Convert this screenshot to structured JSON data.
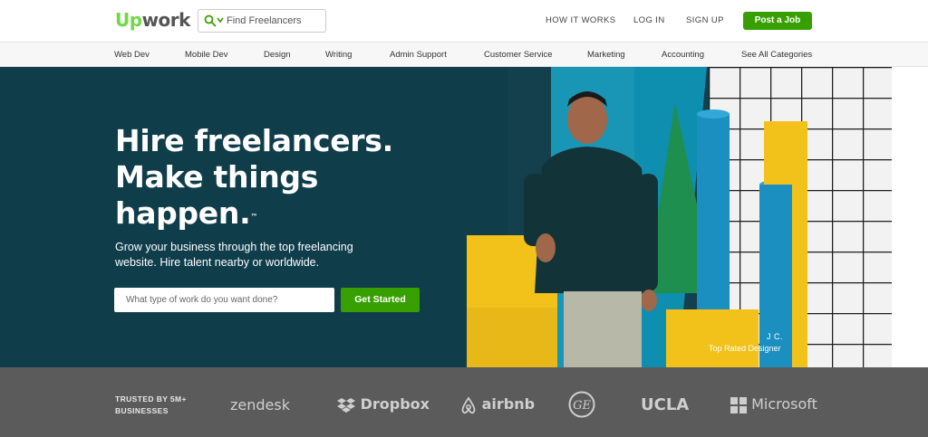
{
  "header": {
    "logo_up": "Up",
    "logo_work": "work",
    "search_placeholder": "Find Freelancers",
    "how_it_works": "HOW IT WORKS",
    "login": "LOG IN",
    "signup": "SIGN UP",
    "post_job": "Post a Job"
  },
  "categories": [
    "Web Dev",
    "Mobile Dev",
    "Design",
    "Writing",
    "Admin Support",
    "Customer Service",
    "Marketing",
    "Accounting",
    "See All Categories"
  ],
  "hero": {
    "headline_line1": "Hire freelancers.",
    "headline_line2": "Make things",
    "headline_line3": "happen.",
    "trademark": "™",
    "subline": "Grow your business through the top freelancing website. Hire talent nearby or worldwide.",
    "input_placeholder": "What type of work do you want done?",
    "cta": "Get Started",
    "credit_name": "J C.",
    "credit_role": "Top Rated Designer"
  },
  "trusted": {
    "label": "TRUSTED BY 5M+ BUSINESSES",
    "brands": [
      "zendesk",
      "Dropbox",
      "airbnb",
      "GE",
      "UCLA",
      "Microsoft"
    ]
  },
  "colors": {
    "brand_green": "#37a000",
    "logo_green": "#6fda44",
    "hero_bg": "#0f3d4a",
    "trusted_bg": "#5b5b5b"
  }
}
